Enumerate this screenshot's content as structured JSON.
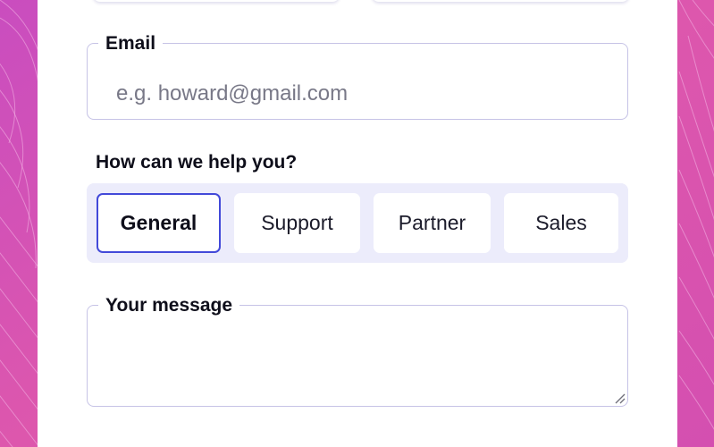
{
  "email": {
    "label": "Email",
    "placeholder": "e.g. howard@gmail.com",
    "value": ""
  },
  "help": {
    "question": "How can we help you?",
    "options": [
      {
        "label": "General",
        "selected": true
      },
      {
        "label": "Support",
        "selected": false
      },
      {
        "label": "Partner",
        "selected": false
      },
      {
        "label": "Sales",
        "selected": false
      }
    ]
  },
  "message": {
    "label": "Your message",
    "value": ""
  },
  "colors": {
    "background": "#d653b4",
    "accent": "#4249d9",
    "field_border": "#c6c3e6",
    "segment_bg": "#ececfb"
  },
  "icons": {
    "resize": "resize-grip-icon"
  }
}
